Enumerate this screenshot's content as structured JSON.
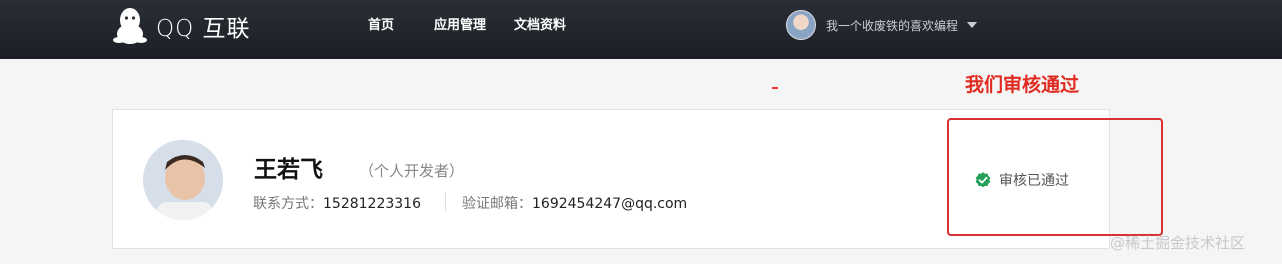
{
  "header": {
    "logo_text": "QQ 互联",
    "nav": [
      "首页",
      "应用管理",
      "文档资料"
    ],
    "user_name": "我一个收废铁的喜欢编程"
  },
  "annotation": "我们审核通过",
  "profile": {
    "name": "王若飞",
    "role": "（个人开发者）",
    "phone_label": "联系方式：",
    "phone": "15281223316",
    "email_label": "验证邮箱：",
    "email": "1692454247@qq.com",
    "status": "审核已通过",
    "status_color": "#25a05a"
  },
  "watermark": "@稀土掘金技术社区"
}
